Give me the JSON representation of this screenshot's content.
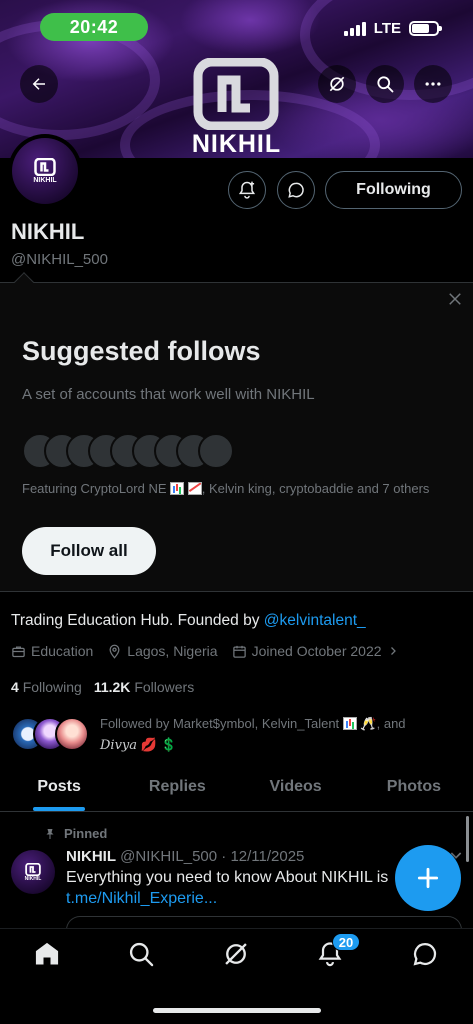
{
  "status_bar": {
    "time": "20:42",
    "network": "LTE"
  },
  "profile": {
    "banner_text": "NIKHIL",
    "avatar_text": "NIKHIL",
    "name": "NIKHIL",
    "handle": "@NIKHIL_500",
    "following_button": "Following",
    "bio_prefix": "Trading Education Hub. Founded by ",
    "bio_mention": "@kelvintalent_",
    "category": "Education",
    "location": "Lagos, Nigeria",
    "joined": "Joined October 2022",
    "following_count": "4",
    "following_label": "Following",
    "followers_count": "11.2K",
    "followers_label": "Followers",
    "followed_by_prefix": "Followed by Market$ymbol, Kelvin_Talent",
    "followed_by_mid": ", and",
    "followed_by_last": "Divya",
    "followed_by_suffix": "💋 💲"
  },
  "suggested": {
    "title": "Suggested follows",
    "subtitle": "A set of accounts that work well with NIKHIL",
    "featuring_prefix": "Featuring CryptoLord NE",
    "featuring_suffix": ", Kelvin king, cryptobaddie and 7 others",
    "follow_all": "Follow all"
  },
  "tabs": [
    {
      "label": "Posts",
      "active": true
    },
    {
      "label": "Replies",
      "active": false
    },
    {
      "label": "Videos",
      "active": false
    },
    {
      "label": "Photos",
      "active": false
    }
  ],
  "post": {
    "pinned_label": "Pinned",
    "avatar_text": "NIKHIL",
    "author": "NIKHIL",
    "meta": " @NIKHIL_500 · 12/11/2025",
    "text": "Everything you need to know About NIKHIL is",
    "link": "t.me/Nikhil_Experie..."
  },
  "bottom_nav": {
    "notification_badge": "20"
  },
  "colors": {
    "accent": "#1d9bf0",
    "status_pill": "#3fbf4a",
    "background": "#000000"
  }
}
